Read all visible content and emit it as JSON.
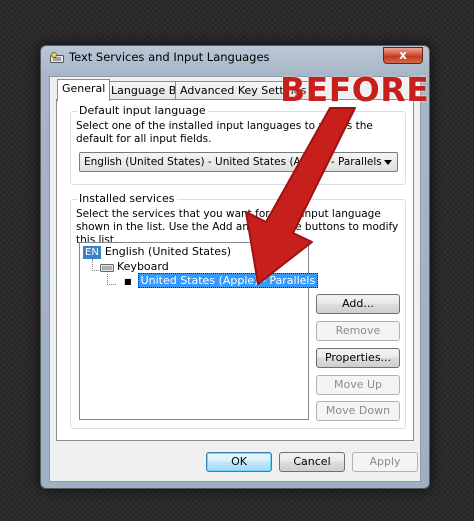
{
  "window": {
    "title": "Text Services and Input Languages",
    "close_label": "x"
  },
  "tabs": [
    "General",
    "Language Bar",
    "Advanced Key Settings"
  ],
  "default_input": {
    "group_title": "Default input language",
    "description": "Select one of the installed input languages to use as the default for all input fields.",
    "selected_value": "English (United States) - United States (Apple) - Parallels"
  },
  "installed_services": {
    "group_title": "Installed services",
    "description": "Select the services that you want for each input language shown in the list. Use the Add and Remove buttons to modify this list.",
    "tree": {
      "language_badge": "EN",
      "language": "English (United States)",
      "category": "Keyboard",
      "service": "United States (Apple) - Parallels"
    },
    "buttons": {
      "add": "Add...",
      "remove": "Remove",
      "properties": "Properties...",
      "move_up": "Move Up",
      "move_down": "Move Down"
    }
  },
  "footer": {
    "ok": "OK",
    "cancel": "Cancel",
    "apply": "Apply"
  },
  "annotation": {
    "text": "BEFORE",
    "color": "#c7201c"
  }
}
